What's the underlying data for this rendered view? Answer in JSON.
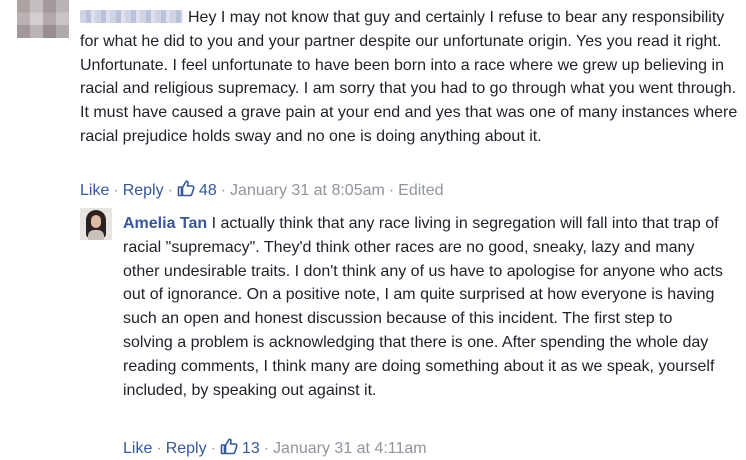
{
  "comments": [
    {
      "author": "",
      "text": "Hey I may not know that guy and certainly I refuse to bear any responsibility for what he did to you and your partner despite our unfortunate origin. Yes you read it right. Unfortunate. I feel unfortunate to have been born into a race where we grew up believing in racial and religious supremacy. I am sorry that you had to go through what you went through. It must have caused a grave pain at your end and yes that was one of many instances where racial prejudice holds sway and no one is doing anything about it.",
      "like_label": "Like",
      "reply_label": "Reply",
      "like_count": "48",
      "timestamp": "January 31 at 8:05am",
      "edited_label": "Edited"
    },
    {
      "author": "Amelia Tan",
      "text": "I actually think that any race living in segregation will fall into that trap of racial \"supremacy\". They'd think other races are no good, sneaky, lazy and many other undesirable traits. I don't think any of us have to apologise for anyone who acts out of ignorance. On a positive note, I am quite surprised at how everyone is having such an open and honest discussion because of this incident. The first step to solving a problem is acknowledging that there is one. After spending the whole day reading comments, I think many are doing something about it as we speak, yourself included, by speaking out against it.",
      "like_label": "Like",
      "reply_label": "Reply",
      "like_count": "13",
      "timestamp": "January 31 at 4:11am"
    }
  ],
  "icons": {
    "like": "thumbs-up-icon"
  },
  "colors": {
    "link": "#365899",
    "meta": "#90949c",
    "text": "#1d2129"
  }
}
